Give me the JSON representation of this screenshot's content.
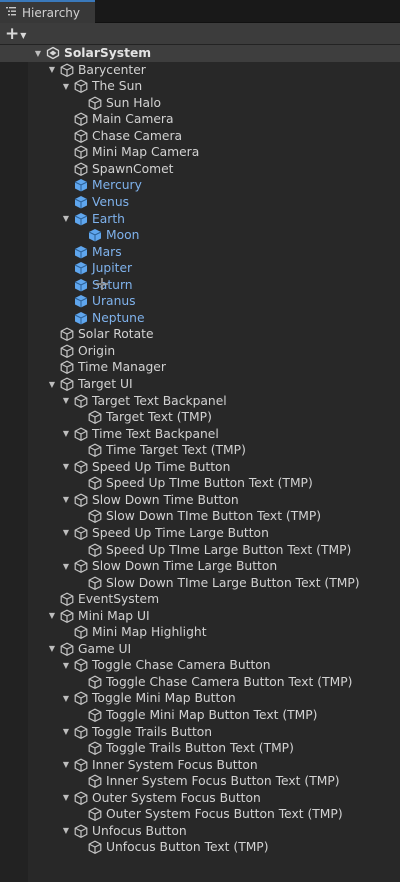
{
  "panel": {
    "tab_label": "Hierarchy",
    "create_label": "+"
  },
  "colors": {
    "prefab_text": "#7fb2ec",
    "normal_text": "#d2d2d2",
    "selected_tab_accent": "#3a79bb"
  },
  "hierarchy": [
    {
      "label": "SolarSystem",
      "depth": 0,
      "expanded": true,
      "kind": "scene"
    },
    {
      "label": "Barycenter",
      "depth": 1,
      "expanded": true,
      "kind": "object"
    },
    {
      "label": "The Sun",
      "depth": 2,
      "expanded": true,
      "kind": "object"
    },
    {
      "label": "Sun Halo",
      "depth": 3,
      "kind": "object"
    },
    {
      "label": "Main Camera",
      "depth": 2,
      "kind": "object"
    },
    {
      "label": "Chase Camera",
      "depth": 2,
      "kind": "object"
    },
    {
      "label": "Mini Map Camera",
      "depth": 2,
      "kind": "object"
    },
    {
      "label": "SpawnComet",
      "depth": 2,
      "kind": "object"
    },
    {
      "label": "Mercury",
      "depth": 2,
      "kind": "prefab"
    },
    {
      "label": "Venus",
      "depth": 2,
      "kind": "prefab"
    },
    {
      "label": "Earth",
      "depth": 2,
      "expanded": true,
      "kind": "prefab"
    },
    {
      "label": "Moon",
      "depth": 3,
      "kind": "prefab"
    },
    {
      "label": "Mars",
      "depth": 2,
      "kind": "prefab"
    },
    {
      "label": "Jupiter",
      "depth": 2,
      "kind": "prefab"
    },
    {
      "label": "Saturn",
      "depth": 2,
      "kind": "prefab"
    },
    {
      "label": "Uranus",
      "depth": 2,
      "kind": "prefab"
    },
    {
      "label": "Neptune",
      "depth": 2,
      "kind": "prefab"
    },
    {
      "label": "Solar Rotate",
      "depth": 1,
      "kind": "object"
    },
    {
      "label": "Origin",
      "depth": 1,
      "kind": "object"
    },
    {
      "label": "Time Manager",
      "depth": 1,
      "kind": "object"
    },
    {
      "label": "Target UI",
      "depth": 1,
      "expanded": true,
      "kind": "object"
    },
    {
      "label": "Target Text Backpanel",
      "depth": 2,
      "expanded": true,
      "kind": "object"
    },
    {
      "label": "Target Text (TMP)",
      "depth": 3,
      "kind": "object"
    },
    {
      "label": "Time Text Backpanel",
      "depth": 2,
      "expanded": true,
      "kind": "object"
    },
    {
      "label": "Time Target Text (TMP)",
      "depth": 3,
      "kind": "object"
    },
    {
      "label": "Speed Up Time Button",
      "depth": 2,
      "expanded": true,
      "kind": "object"
    },
    {
      "label": "Speed Up TIme Button Text (TMP)",
      "depth": 3,
      "kind": "object"
    },
    {
      "label": "Slow Down Time Button",
      "depth": 2,
      "expanded": true,
      "kind": "object"
    },
    {
      "label": "Slow Down TIme Button Text (TMP)",
      "depth": 3,
      "kind": "object"
    },
    {
      "label": "Speed Up Time Large Button",
      "depth": 2,
      "expanded": true,
      "kind": "object"
    },
    {
      "label": "Speed Up TIme Large Button Text (TMP)",
      "depth": 3,
      "kind": "object"
    },
    {
      "label": "Slow Down Time Large Button",
      "depth": 2,
      "expanded": true,
      "kind": "object"
    },
    {
      "label": "Slow Down TIme Large Button Text (TMP)",
      "depth": 3,
      "kind": "object"
    },
    {
      "label": "EventSystem",
      "depth": 1,
      "kind": "object"
    },
    {
      "label": "Mini Map UI",
      "depth": 1,
      "expanded": true,
      "kind": "object"
    },
    {
      "label": "Mini Map Highlight",
      "depth": 2,
      "kind": "object"
    },
    {
      "label": "Game UI",
      "depth": 1,
      "expanded": true,
      "kind": "object"
    },
    {
      "label": "Toggle Chase Camera Button",
      "depth": 2,
      "expanded": true,
      "kind": "object"
    },
    {
      "label": "Toggle Chase Camera Button Text (TMP)",
      "depth": 3,
      "kind": "object"
    },
    {
      "label": "Toggle Mini Map Button",
      "depth": 2,
      "expanded": true,
      "kind": "object"
    },
    {
      "label": "Toggle Mini Map Button Text (TMP)",
      "depth": 3,
      "kind": "object"
    },
    {
      "label": "Toggle Trails Button",
      "depth": 2,
      "expanded": true,
      "kind": "object"
    },
    {
      "label": "Toggle Trails Button Text (TMP)",
      "depth": 3,
      "kind": "object"
    },
    {
      "label": "Inner System Focus Button",
      "depth": 2,
      "expanded": true,
      "kind": "object"
    },
    {
      "label": "Inner System Focus Button Text (TMP)",
      "depth": 3,
      "kind": "object"
    },
    {
      "label": "Outer System Focus Button",
      "depth": 2,
      "expanded": true,
      "kind": "object"
    },
    {
      "label": "Outer System Focus Button Text (TMP)",
      "depth": 3,
      "kind": "object"
    },
    {
      "label": "Unfocus Button",
      "depth": 2,
      "expanded": true,
      "kind": "object"
    },
    {
      "label": "Unfocus Button Text (TMP)",
      "depth": 3,
      "kind": "object"
    }
  ]
}
